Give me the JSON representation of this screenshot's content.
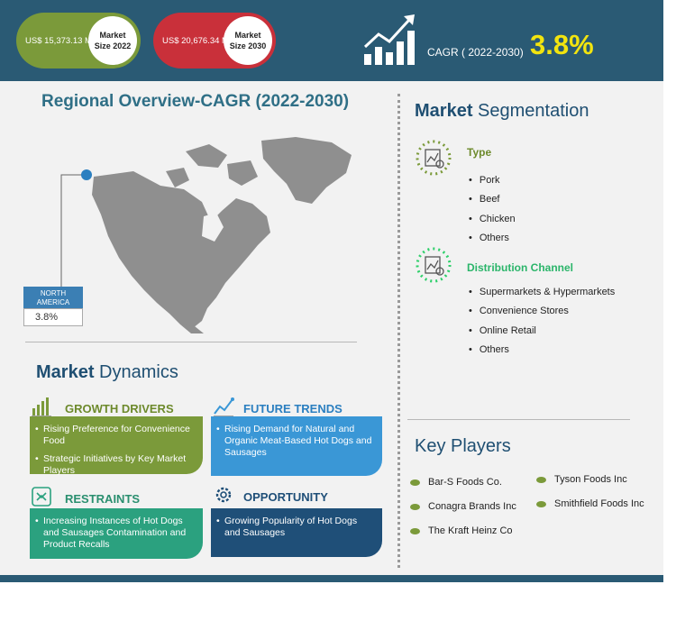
{
  "header": {
    "market_2022_value": "US$  15,373.13  Mn",
    "market_2022_label_line1": "Market",
    "market_2022_label_line2": "Size 2022",
    "market_2030_value": "US$ 20,676.34  Mn",
    "market_2030_label_line1": "Market",
    "market_2030_label_line2": "Size 2030",
    "cagr_label": "CAGR ( 2022-2030)",
    "cagr_value": "3.8%"
  },
  "region": {
    "title": "Regional Overview-CAGR (2022-2030)",
    "north_america_line1": "NORTH",
    "north_america_line2": "AMERICA",
    "north_america_cagr": "3.8%"
  },
  "segmentation": {
    "title_part1": "Market",
    "title_part2": "Segmentation",
    "type": {
      "heading": "Type",
      "items": [
        "Pork",
        "Beef",
        "Chicken",
        "Others"
      ]
    },
    "distribution": {
      "heading": "Distribution Channel",
      "items": [
        "Supermarkets & Hypermarkets",
        "Convenience Stores",
        "Online Retail",
        "Others"
      ]
    }
  },
  "dynamics": {
    "title_part1": "Market",
    "title_part2": "Dynamics",
    "growth_drivers": {
      "heading": "GROWTH DRIVERS",
      "items": [
        "Rising Preference for Convenience Food",
        "Strategic Initiatives by Key Market Players"
      ]
    },
    "future_trends": {
      "heading": "FUTURE TRENDS",
      "items": [
        "Rising Demand for Natural and Organic Meat-Based Hot Dogs and Sausages"
      ]
    },
    "restraints": {
      "heading": "RESTRAINTS",
      "items": [
        "Increasing Instances of Hot Dogs and Sausages Contamination and Product Recalls"
      ]
    },
    "opportunity": {
      "heading": "OPPORTUNITY",
      "items": [
        "Growing Popularity of Hot Dogs and Sausages"
      ]
    }
  },
  "key_players": {
    "title": "Key Players",
    "left": [
      "Bar-S Foods Co.",
      "Conagra Brands Inc",
      "The Kraft Heinz Co"
    ],
    "right": [
      "Tyson Foods Inc",
      "Smithfield Foods Inc"
    ]
  },
  "colors": {
    "header_bg": "#2a5a74",
    "green": "#7b9a3a",
    "red": "#c9303a",
    "blue": "#3a97d6",
    "teal": "#2ba17f",
    "navy": "#1f4f78",
    "cagr_yellow": "#f2e40f"
  }
}
